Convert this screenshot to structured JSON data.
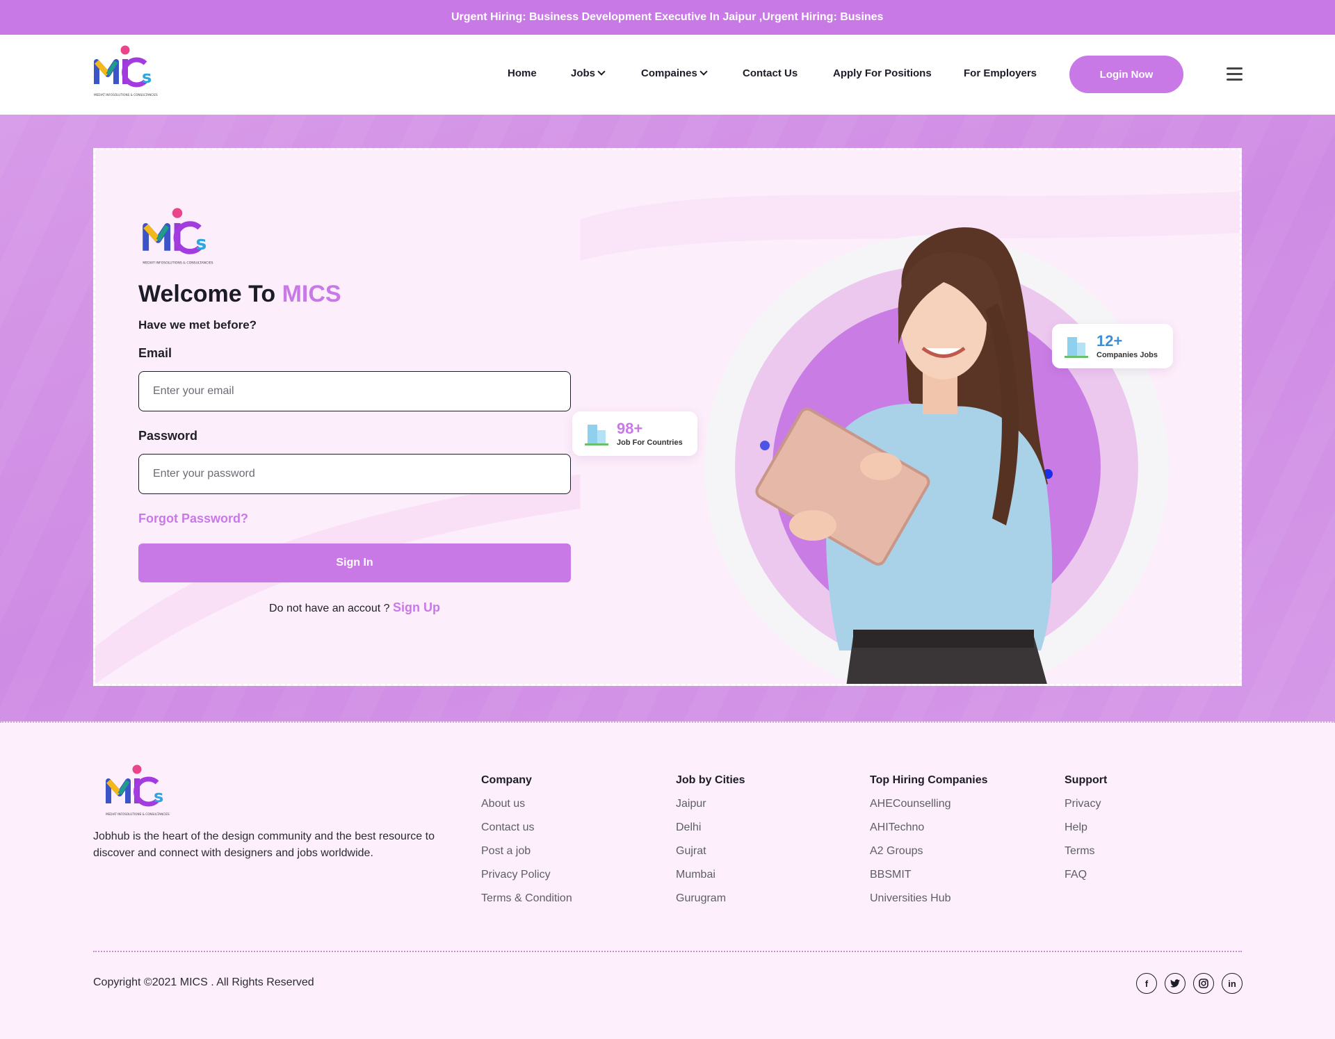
{
  "announcement": {
    "text": "Urgent Hiring: Business Development Executive In Jaipur ,Urgent Hiring: Business Development Executive In Jaipur"
  },
  "header": {
    "nav": [
      {
        "label": "Home"
      },
      {
        "label": "Jobs"
      },
      {
        "label": "Compaines"
      },
      {
        "label": "Contact Us"
      },
      {
        "label": "Apply For Positions"
      },
      {
        "label": "For Employers"
      }
    ],
    "login_label": "Login Now",
    "menu_icon": "hamburger-icon"
  },
  "login": {
    "title_prefix": "Welcome To ",
    "title_brand": "MICS",
    "subtitle": "Have we met before?",
    "email_label": "Email",
    "email_placeholder": "Enter your email",
    "password_label": "Password",
    "password_placeholder": "Enter your password",
    "forgot_label": "Forgot Password?",
    "signin_label": "Sign In",
    "signup_prompt": "Do not have an accout ?",
    "signup_label": "Sign Up"
  },
  "stats": [
    {
      "value": "98+",
      "label": "Job For Countries",
      "color": "#c879e6"
    },
    {
      "value": "12+",
      "label": "Companies Jobs",
      "color": "#3d8fd8"
    }
  ],
  "footer": {
    "description": "Jobhub is the heart of the design community and the best resource to discover and connect with designers and jobs worldwide.",
    "columns": [
      {
        "title": "Company",
        "links": [
          "About us",
          "Contact us",
          "Post a job",
          "Privacy Policy",
          "Terms & Condition"
        ]
      },
      {
        "title": "Job by Cities",
        "links": [
          "Jaipur",
          "Delhi",
          "Gujrat",
          "Mumbai",
          "Gurugram"
        ]
      },
      {
        "title": "Top Hiring Companies",
        "links": [
          "AHECounselling",
          "AHITechno",
          "A2 Groups",
          "BBSMIT",
          "Universities Hub"
        ]
      },
      {
        "title": "Support",
        "links": [
          "Privacy",
          "Help",
          "Terms",
          "FAQ"
        ]
      }
    ],
    "copyright": "Copyright ©2021 MICS . All Rights Reserved",
    "socials": [
      "facebook-icon",
      "twitter-icon",
      "instagram-icon",
      "linkedin-icon"
    ]
  },
  "colors": {
    "accent": "#c879e6",
    "dark": "#1c1c28"
  }
}
